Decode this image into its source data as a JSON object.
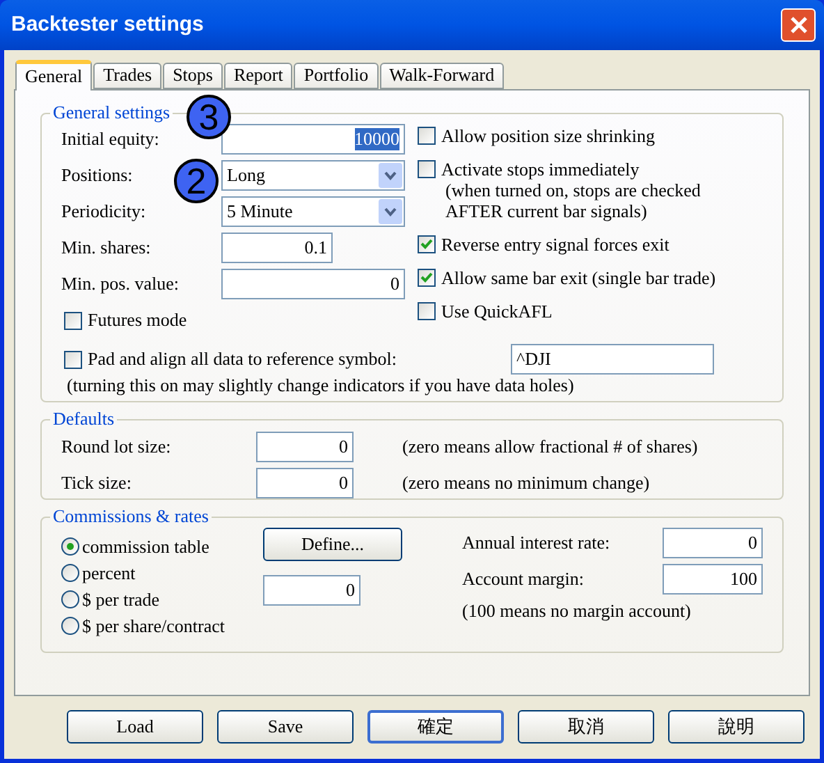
{
  "window": {
    "title": "Backtester settings"
  },
  "tabs": [
    {
      "label": "General",
      "selected": true
    },
    {
      "label": "Trades",
      "selected": false
    },
    {
      "label": "Stops",
      "selected": false
    },
    {
      "label": "Report",
      "selected": false
    },
    {
      "label": "Portfolio",
      "selected": false
    },
    {
      "label": "Walk-Forward",
      "selected": false
    }
  ],
  "general_settings": {
    "title": "General settings",
    "fields": [
      {
        "kind": "text",
        "label": "Initial equity:",
        "value": "10000",
        "text_selected": true
      },
      {
        "kind": "select",
        "label": "Positions:",
        "value": "Long"
      },
      {
        "kind": "select",
        "label": "Periodicity:",
        "value": "5 Minute"
      },
      {
        "kind": "short-text",
        "label": "Min. shares:",
        "value": "0.1",
        "text_selected": false
      },
      {
        "kind": "text",
        "label": "Min. pos. value:",
        "value": "0",
        "text_selected": false
      }
    ],
    "options": [
      {
        "label": "Allow position size shrinking",
        "checked": false
      },
      {
        "label": "Activate stops immediately",
        "checked": false,
        "note_lines": [
          "(when turned on, stops are checked",
          "AFTER current bar signals)"
        ]
      },
      {
        "label": "Reverse entry signal forces exit",
        "checked": true
      },
      {
        "label": "Allow same bar exit (single bar trade)",
        "checked": true
      },
      {
        "label": "Use QuickAFL",
        "checked": false
      }
    ],
    "futures_mode": {
      "label": "Futures mode",
      "checked": false
    },
    "pad_align": {
      "label": "Pad and align all data to reference symbol:",
      "checked": false,
      "symbol": "^DJI",
      "note": "(turning this on may slightly change indicators if you have data holes)"
    }
  },
  "callouts": [
    {
      "label": "3"
    },
    {
      "label": "2"
    }
  ],
  "defaults": {
    "title": "Defaults",
    "fields": [
      {
        "label": "Round lot size:",
        "value": "0",
        "note": "(zero means allow fractional # of shares)"
      },
      {
        "label": "Tick size:",
        "value": "0",
        "note": "(zero means no minimum change)"
      }
    ]
  },
  "commissions": {
    "title": "Commissions & rates",
    "modes": [
      {
        "label": "commission table",
        "selected": true
      },
      {
        "label": "percent",
        "selected": false
      },
      {
        "label": "$ per trade",
        "selected": false
      },
      {
        "label": "$ per share/contract",
        "selected": false
      }
    ],
    "define_button": "Define...",
    "amount": "0",
    "fields": [
      {
        "label": "Annual interest rate:",
        "value": "0"
      },
      {
        "label": "Account margin:",
        "value": "100"
      }
    ],
    "note": "(100 means no margin account)"
  },
  "buttons": [
    {
      "label": "Load",
      "default": false
    },
    {
      "label": "Save",
      "default": false
    },
    {
      "label": "確定",
      "default": true
    },
    {
      "label": "取消",
      "default": false
    },
    {
      "label": "說明",
      "default": false
    }
  ]
}
